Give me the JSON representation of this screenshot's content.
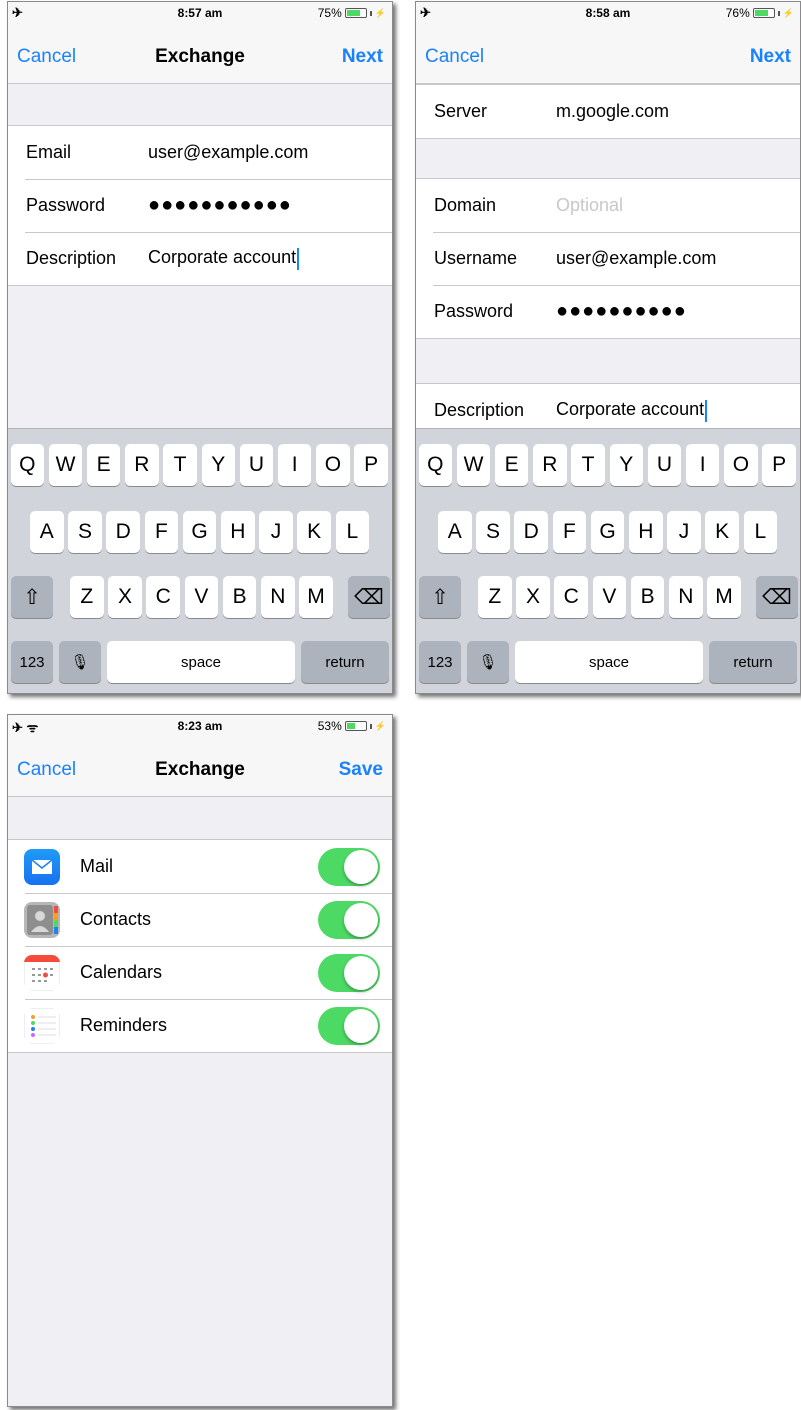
{
  "screen1": {
    "status": {
      "left_icons": "✈",
      "time": "8:57 am",
      "battery": "75%",
      "battery_fraction": 0.75
    },
    "nav": {
      "left": "Cancel",
      "title": "Exchange",
      "right": "Next"
    },
    "fields": [
      {
        "label": "Email",
        "value": "user@example.com",
        "type": "text"
      },
      {
        "label": "Password",
        "value": "●●●●●●●●●●●",
        "type": "password"
      },
      {
        "label": "Description",
        "value": "Corporate account",
        "type": "text",
        "focused": true
      }
    ],
    "keyboard": {
      "row1": [
        "Q",
        "W",
        "E",
        "R",
        "T",
        "Y",
        "U",
        "I",
        "O",
        "P"
      ],
      "row2": [
        "A",
        "S",
        "D",
        "F",
        "G",
        "H",
        "J",
        "K",
        "L"
      ],
      "row3": [
        "Z",
        "X",
        "C",
        "V",
        "B",
        "N",
        "M"
      ],
      "shift": "⇧",
      "delete": "⌫",
      "numbers": "123",
      "mic": "🎙",
      "space": "space",
      "return": "return"
    }
  },
  "screen2": {
    "status": {
      "left_icons": "✈",
      "time": "8:58 am",
      "battery": "76%",
      "battery_fraction": 0.76
    },
    "nav": {
      "left": "Cancel",
      "title": "",
      "right": "Next"
    },
    "server": {
      "label": "Server",
      "value": "m.google.com"
    },
    "fields": [
      {
        "label": "Domain",
        "placeholder": "Optional"
      },
      {
        "label": "Username",
        "value": "user@example.com"
      },
      {
        "label": "Password",
        "value": "●●●●●●●●●●"
      }
    ],
    "description": {
      "label": "Description",
      "value": "Corporate account"
    },
    "keyboard": {
      "row1": [
        "Q",
        "W",
        "E",
        "R",
        "T",
        "Y",
        "U",
        "I",
        "O",
        "P"
      ],
      "row2": [
        "A",
        "S",
        "D",
        "F",
        "G",
        "H",
        "J",
        "K",
        "L"
      ],
      "row3": [
        "Z",
        "X",
        "C",
        "V",
        "B",
        "N",
        "M"
      ],
      "shift": "⇧",
      "delete": "⌫",
      "numbers": "123",
      "mic": "🎙",
      "space": "space",
      "return": "return"
    }
  },
  "screen3": {
    "status": {
      "left_icons": "✈ ᯤ",
      "time": "8:23 am",
      "battery": "53%",
      "battery_fraction": 0.53
    },
    "nav": {
      "left": "Cancel",
      "title": "Exchange",
      "right": "Save"
    },
    "services": [
      {
        "label": "Mail",
        "icon": "mail-icon",
        "enabled": true
      },
      {
        "label": "Contacts",
        "icon": "contacts-icon",
        "enabled": true
      },
      {
        "label": "Calendars",
        "icon": "calendar-icon",
        "enabled": true
      },
      {
        "label": "Reminders",
        "icon": "reminders-icon",
        "enabled": true
      }
    ]
  },
  "colors": {
    "accent": "#1a82fb",
    "toggle_on": "#4cd964",
    "background": "#efeff4"
  }
}
